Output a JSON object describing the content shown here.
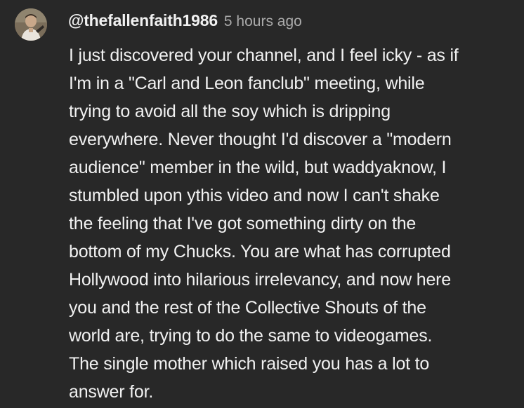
{
  "comment": {
    "author_handle": "@thefallenfaith1986",
    "timestamp": "5 hours ago",
    "avatar_icon": "user-avatar-photo",
    "body_lines": [
      "I just discovered your channel, and I feel icky - as if",
      "I'm in a \"Carl and Leon fanclub\" meeting, while",
      "trying to avoid all the soy which is dripping",
      "everywhere.  Never thought I'd discover a \"modern",
      "audience\" member in the wild, but waddyaknow, I",
      "stumbled upon ythis video and now I can't shake",
      "the feeling that I've got something dirty on the",
      "bottom of my Chucks. You are what has corrupted",
      "Hollywood into hilarious irrelevancy, and now here",
      "you and the rest of the Collective Shouts of the",
      "world are, trying to do the same to videogames.",
      "The single mother which raised you has a lot to",
      "answer for."
    ]
  },
  "colors": {
    "background": "#282828",
    "text": "#f1f1f1",
    "timestamp": "#aaaaaa"
  }
}
